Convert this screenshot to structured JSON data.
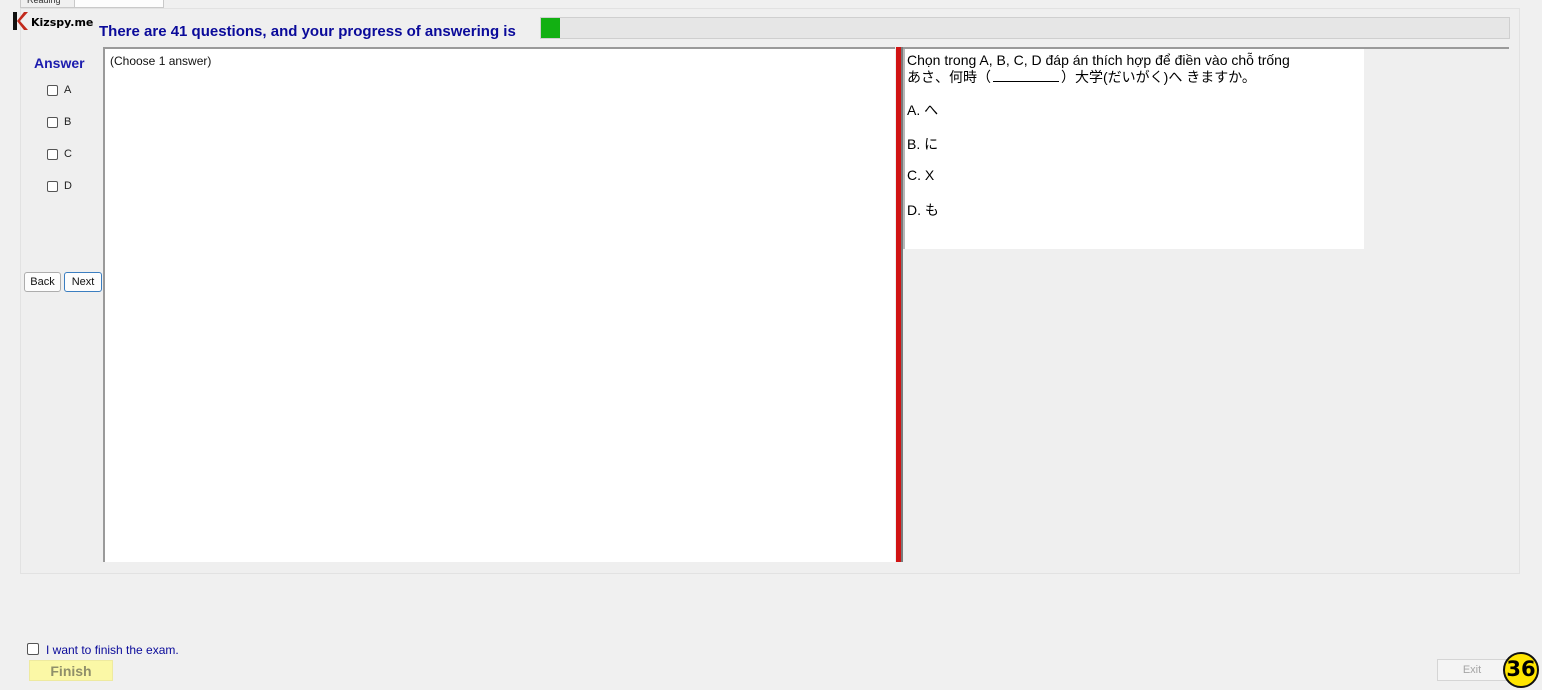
{
  "tabs": [
    {
      "label": "Reading"
    },
    {
      "label": ""
    }
  ],
  "logo": {
    "text": "Kizspy.me",
    "icon": "k-logo-icon",
    "accent_color": "#c22a1c"
  },
  "progress": {
    "label": "There are 41 questions, and your progress of answering is",
    "total_questions": 41,
    "fraction_answered": 0.02,
    "fill_color": "#12b012"
  },
  "answer": {
    "title": "Answer",
    "options": [
      "A",
      "B",
      "C",
      "D"
    ]
  },
  "nav": {
    "back_label": "Back",
    "next_label": "Next"
  },
  "answer_panel": {
    "hint": "(Choose 1 answer)"
  },
  "question": {
    "instruction": "Chọn trong A, B, C, D đáp án thích hợp để điền vào chỗ trống",
    "sentence_before": "あさ、何時（",
    "sentence_after": "）大学(だいがく)へ きますか。",
    "choices": [
      "A.  へ",
      "B.  に",
      "C.  X",
      "D.  も"
    ]
  },
  "footer": {
    "finish_check_label": "I want to finish the exam.",
    "finish_label": "Finish",
    "exit_label": "Exit",
    "timer_value": "36"
  }
}
